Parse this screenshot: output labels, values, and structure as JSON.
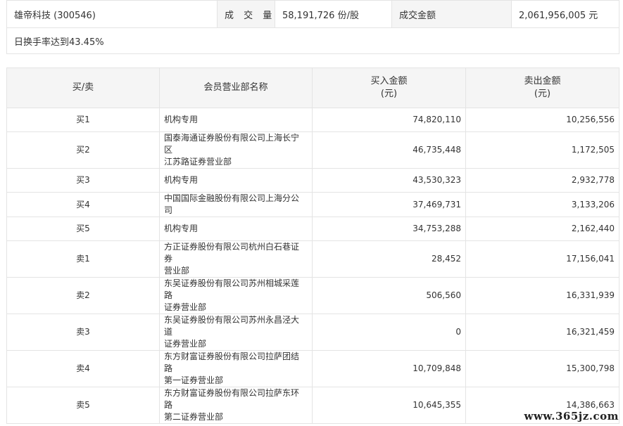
{
  "summary": {
    "stock": "雄帝科技 (300546)",
    "volume_label": "成 交 量",
    "volume_value": "58,191,726 份/股",
    "amount_label": "成交金额",
    "amount_value": "2,061,956,005 元",
    "note": "日换手率达到43.45%"
  },
  "table": {
    "headers": {
      "side": "买/卖",
      "dept": "会员营业部名称",
      "buy_line1": "买入金额",
      "buy_line2": "(元)",
      "sell_line1": "卖出金额",
      "sell_line2": "(元)"
    },
    "rows": [
      {
        "side": "买1",
        "dept_line1": "机构专用",
        "dept_line2": "",
        "buy": "74,820,110",
        "sell": "10,256,556"
      },
      {
        "side": "买2",
        "dept_line1": "国泰海通证券股份有限公司上海长宁区",
        "dept_line2": "江苏路证券营业部",
        "buy": "46,735,448",
        "sell": "1,172,505"
      },
      {
        "side": "买3",
        "dept_line1": "机构专用",
        "dept_line2": "",
        "buy": "43,530,323",
        "sell": "2,932,778"
      },
      {
        "side": "买4",
        "dept_line1": "中国国际金融股份有限公司上海分公司",
        "dept_line2": "",
        "buy": "37,469,731",
        "sell": "3,133,206"
      },
      {
        "side": "买5",
        "dept_line1": "机构专用",
        "dept_line2": "",
        "buy": "34,753,288",
        "sell": "2,162,440"
      },
      {
        "side": "卖1",
        "dept_line1": "方正证券股份有限公司杭州白石巷证券",
        "dept_line2": "营业部",
        "buy": "28,452",
        "sell": "17,156,041"
      },
      {
        "side": "卖2",
        "dept_line1": "东吴证券股份有限公司苏州相城采莲路",
        "dept_line2": "证券营业部",
        "buy": "506,560",
        "sell": "16,331,939"
      },
      {
        "side": "卖3",
        "dept_line1": "东吴证券股份有限公司苏州永昌泾大道",
        "dept_line2": "证券营业部",
        "buy": "0",
        "sell": "16,321,459"
      },
      {
        "side": "卖4",
        "dept_line1": "东方财富证券股份有限公司拉萨团结路",
        "dept_line2": "第一证券营业部",
        "buy": "10,709,848",
        "sell": "15,300,798"
      },
      {
        "side": "卖5",
        "dept_line1": "东方财富证券股份有限公司拉萨东环路",
        "dept_line2": "第二证券营业部",
        "buy": "10,645,355",
        "sell": "14,386,663"
      }
    ]
  },
  "watermark": "www.365jz.com"
}
